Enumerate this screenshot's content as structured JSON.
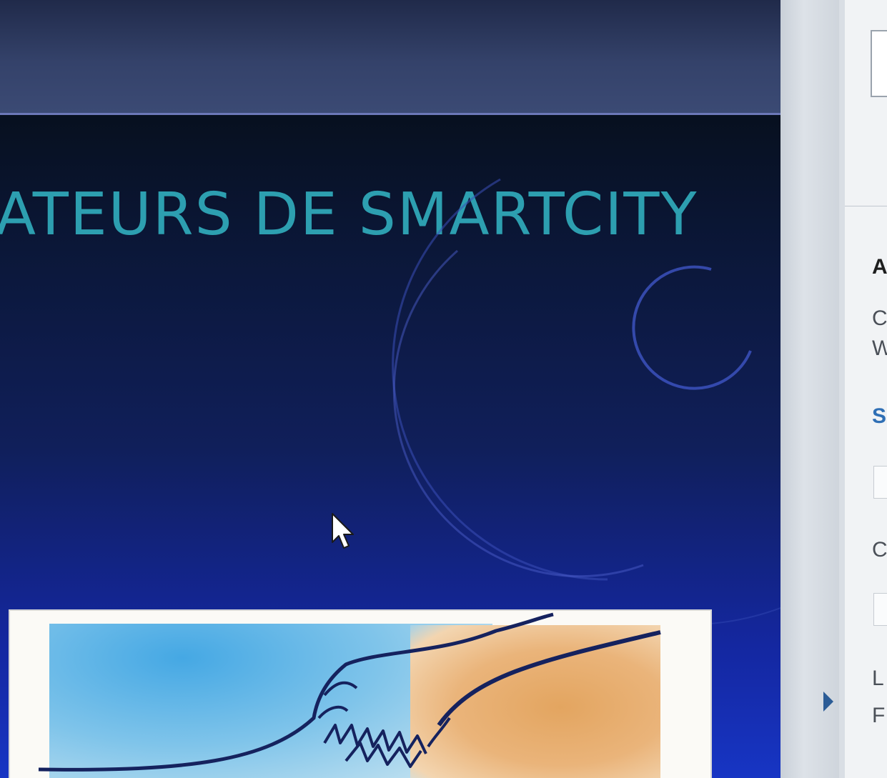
{
  "slide": {
    "title": "ATEURS DE SMARTCITY",
    "title_color": "#2d9fb0"
  },
  "side_panel": {
    "letters": [
      "A",
      "C",
      "W",
      "S",
      "C",
      "L",
      "F"
    ]
  },
  "icons": {
    "cursor": "mouse-pointer-icon",
    "expand": "expand-arrow-icon"
  }
}
